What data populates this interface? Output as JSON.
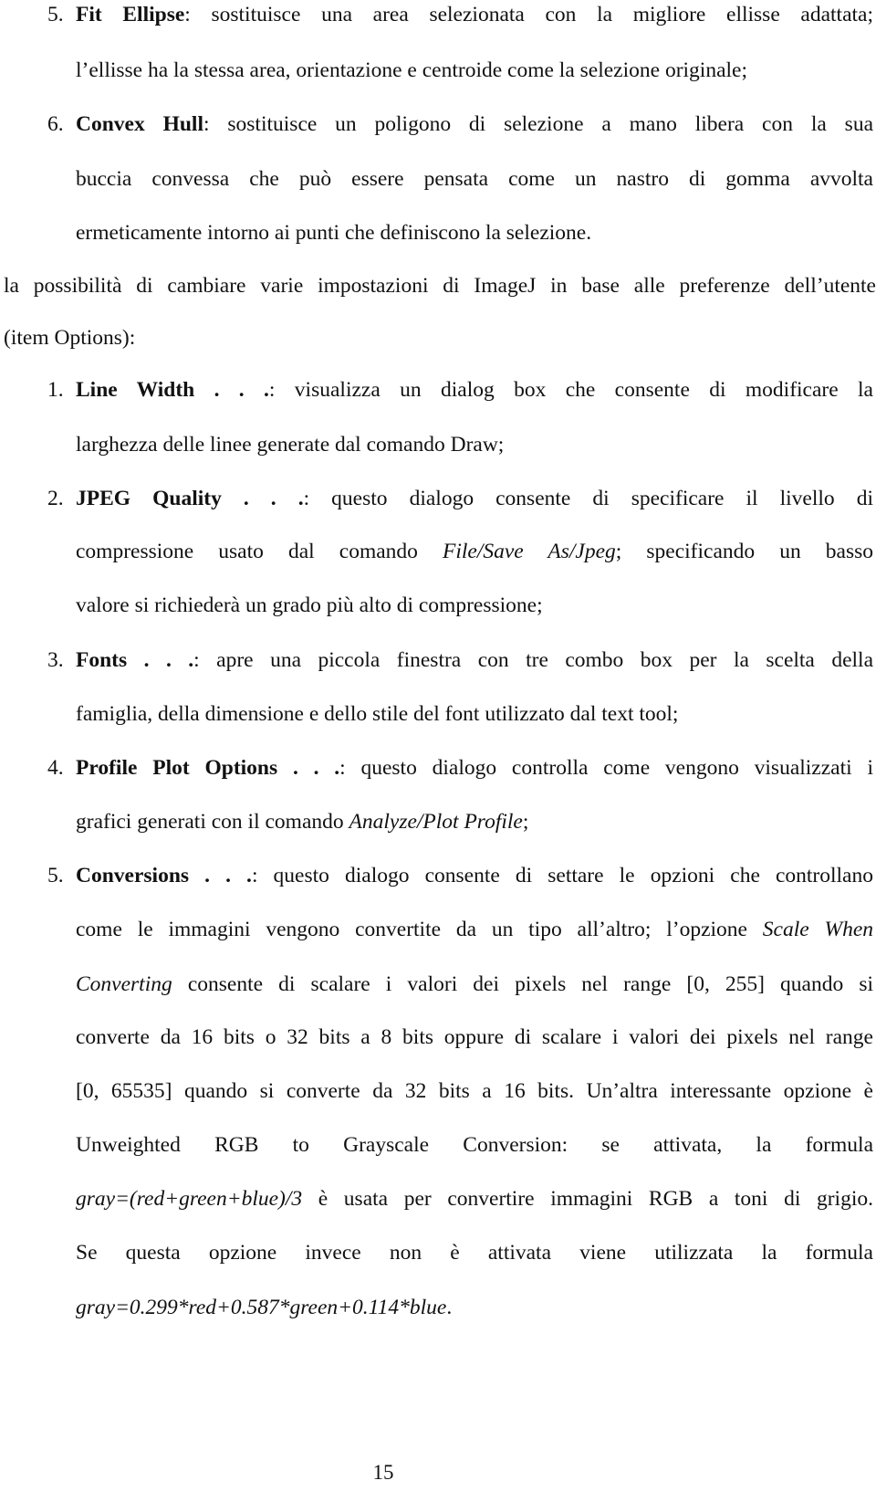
{
  "list_a": [
    {
      "number": "5.",
      "title": "Fit Ellipse",
      "lines": [
        ": sostituisce una area selezionata con la migliore ellisse adattata;",
        "l’ellisse ha la stessa area, orientazione e centroide come la selezione originale;"
      ]
    },
    {
      "number": "6.",
      "title": "Convex Hull",
      "lines": [
        ": sostituisce un poligono di selezione a mano libera con la sua",
        "buccia convessa che può essere pensata come un nastro di gomma avvolta",
        "ermeticamente intorno ai punti che definiscono la selezione."
      ]
    }
  ],
  "intro": {
    "line1": "la possibilità di cambiare varie impostazioni di ImageJ in base alle preferenze dell’utente",
    "line2": "(item Options):"
  },
  "options": [
    {
      "number": "1.",
      "title": "Line Width . . .",
      "line1": ": visualizza un dialog box che consente di modificare la",
      "line2": "larghezza delle linee generate dal comando Draw;"
    },
    {
      "number": "2.",
      "title": "JPEG Quality . . .",
      "line1": ": questo dialogo consente di specificare il livello di",
      "line2_pre": "compressione usato dal comando ",
      "line2_ital": "File/Save As/Jpeg",
      "line2_post": "; specificando un basso",
      "line3": "valore si richiederà un grado più alto di compressione;"
    },
    {
      "number": "3.",
      "title": "Fonts . . .",
      "line1": ": apre una piccola finestra con tre combo box per la scelta della",
      "line2": "famiglia, della dimensione e dello stile del font utilizzato dal text tool;"
    },
    {
      "number": "4.",
      "title": "Profile Plot Options . . .",
      "line1": ": questo dialogo controlla come vengono visualizzati i",
      "line2_pre": "grafici generati con il comando ",
      "line2_ital": "Analyze/Plot Profile",
      "line2_post": ";"
    },
    {
      "number": "5.",
      "title": "Conversions . . .",
      "line1": ": questo dialogo consente di settare le opzioni che controllano",
      "line2_pre": "come le immagini vengono convertite da un tipo all’altro; l’opzione ",
      "line2_ital": "Scale When",
      "line3_ital": "Converting",
      "line3_post": " consente di scalare i valori dei pixels nel range [0, 255] quando si",
      "line4": "converte da 16 bits o 32 bits a 8 bits oppure di scalare i valori dei pixels nel range",
      "line5": "[0, 65535] quando si converte da 32 bits a 16 bits. Un’altra interessante opzione è",
      "line6": "Unweighted RGB to Grayscale Conversion: se attivata, la formula",
      "line7_ital": "gray=(red+green+blue)/3",
      "line7_post": " è usata per convertire immagini RGB a toni di grigio.",
      "line8": "Se questa opzione invece non è attivata viene utilizzata la formula",
      "line9_ital": "gray=0.299*red+0.587*green+0.114*blue",
      "line9_post": "."
    }
  ],
  "page_number": "15"
}
